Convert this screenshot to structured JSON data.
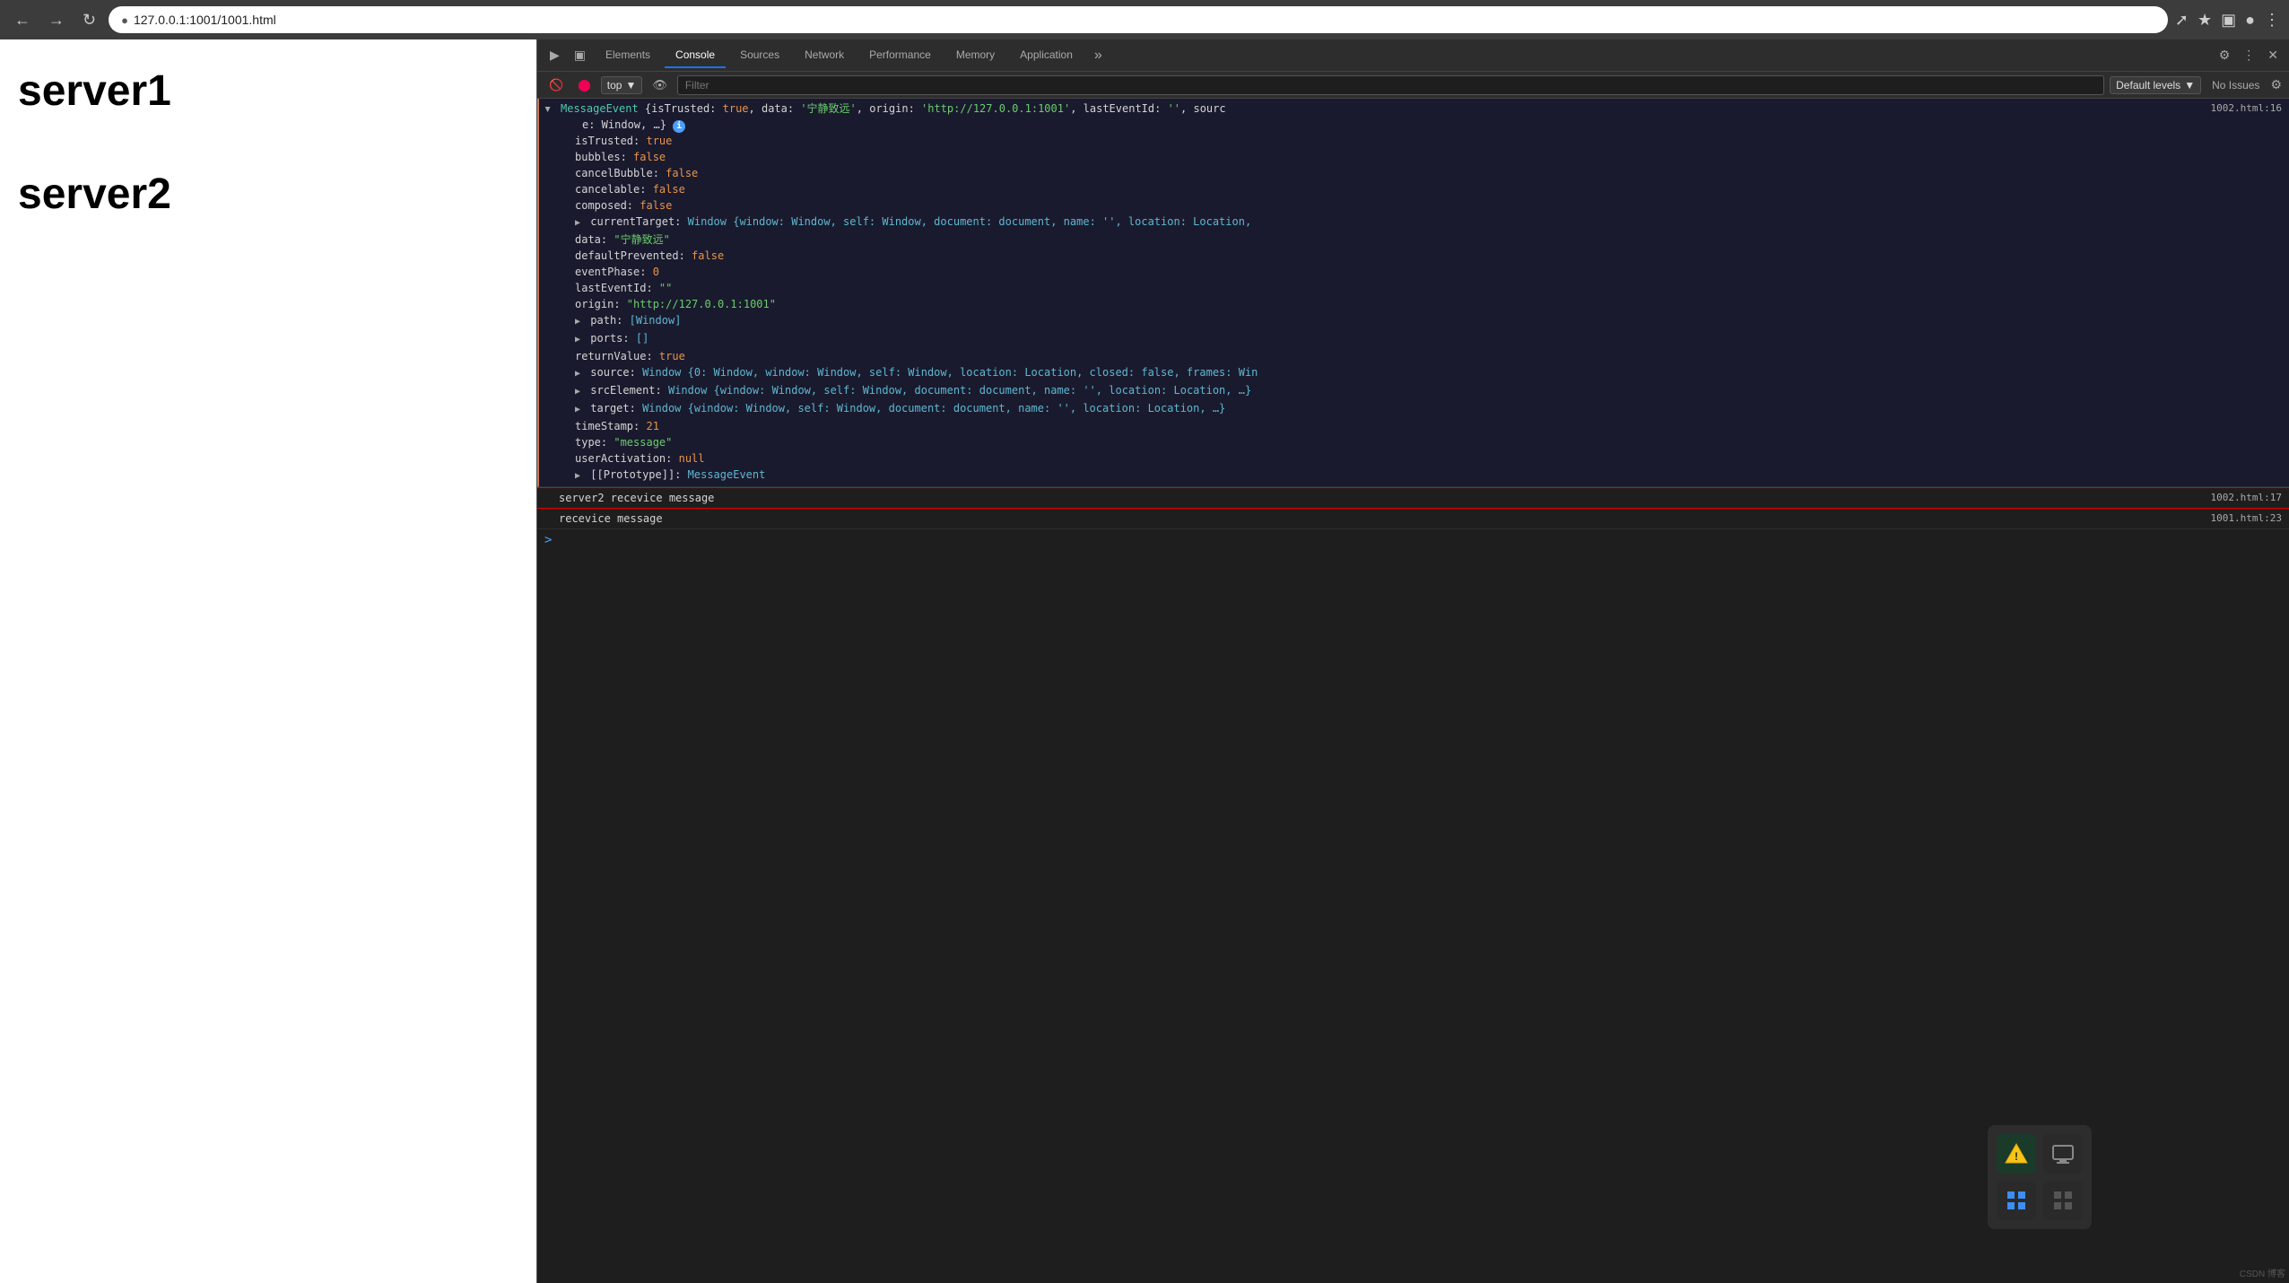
{
  "browser": {
    "url": "127.0.0.1:1001/1001.html",
    "nav": {
      "back": "←",
      "forward": "→",
      "reload": "↻"
    }
  },
  "page": {
    "server1_label": "server1",
    "server2_label": "server2"
  },
  "devtools": {
    "tabs": [
      "Elements",
      "Console",
      "Sources",
      "Network",
      "Performance",
      "Memory",
      "Application"
    ],
    "active_tab": "Console",
    "overflow": "»",
    "context": "top",
    "filter_placeholder": "Filter",
    "levels_label": "Default levels",
    "issues_label": "No Issues",
    "console_lines": [
      {
        "type": "object",
        "file_ref": "1002.html:16",
        "header": "MessageEvent {isTrusted: true, data: '宁静致远', origin: 'http://127.0.0.1:1001', lastEventId: '', sourc",
        "header_suffix": "e: Window, …}",
        "expanded": true,
        "props": [
          {
            "key": "isTrusted:",
            "value": "true",
            "color": "orange"
          },
          {
            "key": "bubbles:",
            "value": "false",
            "color": "orange"
          },
          {
            "key": "cancelBubble:",
            "value": "false",
            "color": "orange"
          },
          {
            "key": "cancelable:",
            "value": "false",
            "color": "orange"
          },
          {
            "key": "composed:",
            "value": "false",
            "color": "orange"
          },
          {
            "key": "currentTarget:",
            "value": "Window {window: Window, self: Window, document: document, name: '', location: Location,",
            "color": "cyan",
            "expandable": true
          },
          {
            "key": "data:",
            "value": "\"宁静致远\"",
            "color": "green"
          },
          {
            "key": "defaultPrevented:",
            "value": "false",
            "color": "orange"
          },
          {
            "key": "eventPhase:",
            "value": "0",
            "color": "orange"
          },
          {
            "key": "lastEventId:",
            "value": "\"\"",
            "color": "green"
          },
          {
            "key": "origin:",
            "value": "\"http://127.0.0.1:1001\"",
            "color": "green"
          },
          {
            "key": "path:",
            "value": "[Window]",
            "color": "cyan",
            "expandable": true
          },
          {
            "key": "ports:",
            "value": "[]",
            "color": "cyan",
            "expandable": true
          },
          {
            "key": "returnValue:",
            "value": "true",
            "color": "orange"
          },
          {
            "key": "source:",
            "value": "Window {0: Window, window: Window, self: Window, location: Location, closed: false, frames: Win",
            "color": "cyan",
            "expandable": true
          },
          {
            "key": "srcElement:",
            "value": "Window {window: Window, self: Window, document: document, name: '', location: Location, …}",
            "color": "cyan",
            "expandable": true
          },
          {
            "key": "target:",
            "value": "Window {window: Window, self: Window, document: document, name: '', location: Location, …}",
            "color": "cyan",
            "expandable": true
          },
          {
            "key": "timeStamp:",
            "value": "21",
            "color": "orange"
          },
          {
            "key": "type:",
            "value": "\"message\"",
            "color": "green"
          },
          {
            "key": "userActivation:",
            "value": "null",
            "color": "orange"
          },
          {
            "key": "[[Prototype]]:",
            "value": "MessageEvent",
            "color": "cyan",
            "expandable": true
          }
        ]
      },
      {
        "type": "log",
        "file_ref": "1002.html:17",
        "text": "server2 recevice message",
        "border_red": true
      },
      {
        "type": "log",
        "file_ref": "1001.html:23",
        "text": "recevice message"
      }
    ],
    "prompt_symbol": ">",
    "watermark": "CSDN 博客"
  },
  "app_icons": {
    "icon1": "⚠",
    "icon2": "▣",
    "icon3": "⊞",
    "icon4": "▪"
  }
}
